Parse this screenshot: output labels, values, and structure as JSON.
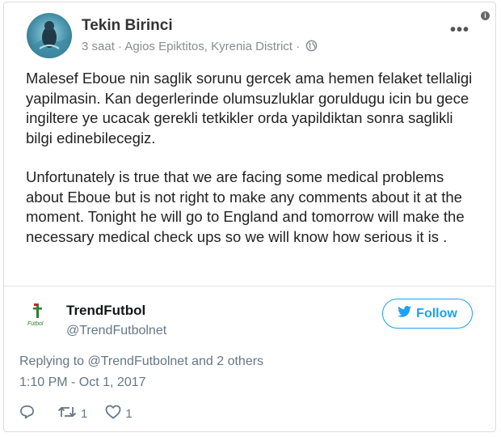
{
  "facebook_post": {
    "author": "Tekin Birinci",
    "time": "3 saat",
    "separator": "·",
    "location": "Agios Epiktitos, Kyrenia District",
    "separator2": "·",
    "more_label": "•••",
    "info_label": "i",
    "paragraphs": [
      "Malesef Eboue  nin saglik sorunu gercek ama hemen felaket tellaligi yapilmasin. Kan degerlerinde olumsuzluklar goruldugu icin bu gece ingiltere ye ucacak gerekli tetkikler orda yapildiktan sonra saglikli bilgi edinebilecegiz.",
      "Unfortunately is true that we are facing some  medical problems about Eboue  but is not right to make any comments about it at the moment. Tonight he will go to England and tomorrow will make the necessary medical check ups so we will know how serious it is ."
    ]
  },
  "tweet": {
    "display_name": "TrendFutbol",
    "handle": "@TrendFutbolnet",
    "logo_text": "Futbol",
    "follow_label": "Follow",
    "replying_to": "Replying to @TrendFutbolnet and 2 others",
    "timestamp": "1:10 PM - Oct 1, 2017",
    "retweets": "1",
    "likes": "1"
  },
  "colors": {
    "twitter_blue": "#1da1f2",
    "logo_green": "#2e7d32",
    "text_gray": "#657786"
  },
  "icons": [
    "info-icon",
    "globe-icon",
    "more-options-icon",
    "twitter-bird-icon",
    "reply-icon",
    "retweet-icon",
    "like-icon"
  ]
}
